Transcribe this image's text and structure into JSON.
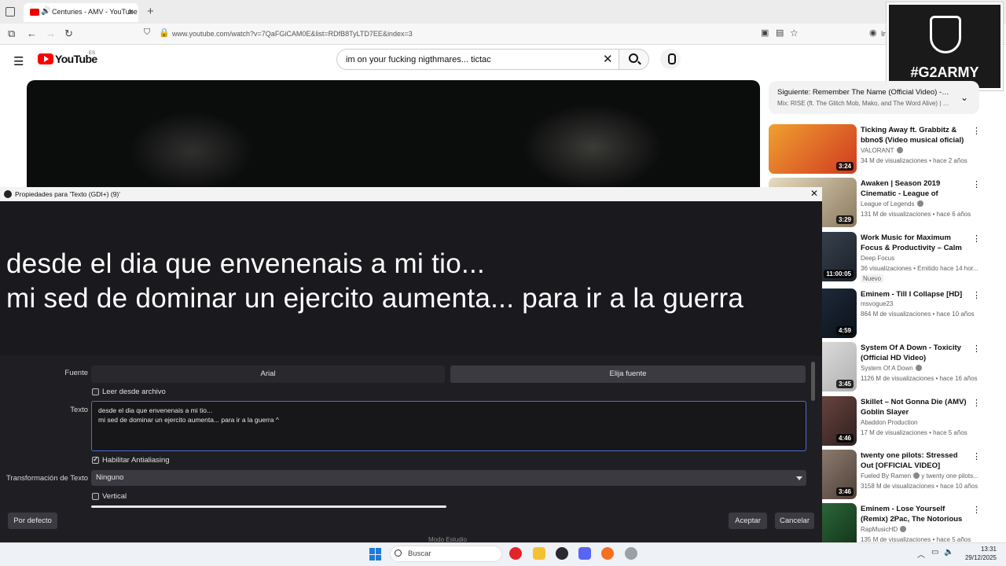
{
  "browser": {
    "tab_title": "Centuries - AMV - YouTube",
    "url": "www.youtube.com/watch?v=7QaFGiCAM0E&list=RDfB8TyLTD7EE&index=3",
    "profile_label": "In"
  },
  "youtube": {
    "logo": "YouTube",
    "country": "ES",
    "search_query": "im on your fucking nigthmares... tictac",
    "up_next": {
      "label": "Siguiente:",
      "title": "Remember The Name (Official Video) - F...",
      "subtitle": "Mix: RISE (ft. The Glitch Mob, Mako, and The Word Alive) | W..."
    },
    "recommendations": [
      {
        "title": "Ticking Away ft. Grabbitz & bbno$ (Video musical oficial) /...",
        "channel": "VALORANT",
        "verified": true,
        "meta": "34 M de visualizaciones • hace 2 años",
        "duration": "3:24",
        "badge": "",
        "color": "#e0542a"
      },
      {
        "title": "Awaken | Season 2019 Cinematic - League of Legend...",
        "channel": "League of Legends",
        "verified": true,
        "meta": "131 M de visualizaciones • hace 6 años",
        "duration": "3:29",
        "badge": "",
        "color": "#c9b690"
      },
      {
        "title": "Work Music for Maximum Focus & Productivity – Calm ...",
        "channel": "Deep Focus",
        "verified": false,
        "meta": "36 visualizaciones • Emitido hace 14 hor...",
        "duration": "11:00:05",
        "badge": "Nuevo",
        "color": "#2e3540"
      },
      {
        "title": "Eminem - Till I Collapse [HD]",
        "channel": "msvogue23",
        "verified": false,
        "meta": "864 M de visualizaciones • hace 10 años",
        "duration": "4:59",
        "badge": "",
        "color": "#1e2c3c"
      },
      {
        "title": "System Of A Down - Toxicity (Official HD Video)",
        "channel": "System Of A Down",
        "verified": true,
        "meta": "1126 M de visualizaciones • hace 16 años",
        "duration": "3:45",
        "badge": "",
        "color": "#3a3030"
      },
      {
        "title": "Skillet – Not Gonna Die (AMV) Goblin Slayer",
        "channel": "Abaddon Production",
        "verified": false,
        "meta": "17 M de visualizaciones • hace 5 años",
        "duration": "4:46",
        "badge": "",
        "color": "#5a4040"
      },
      {
        "title": "twenty one pilots: Stressed Out [OFFICIAL VIDEO]",
        "channel": "Fueled By Ramen",
        "verified": true,
        "meta": "3158 M de visualizaciones • hace 10 años",
        "duration": "3:46",
        "badge": "",
        "color": "#7a6a60",
        "channel_extra": "y twenty one pilots..."
      },
      {
        "title": "Eminem - Lose Yourself (Remix) 2Pac, The Notorious B.I.G., ...",
        "channel": "RapMusicHD",
        "verified": true,
        "meta": "135 M de visualizaciones • hace 5 años",
        "duration": "",
        "badge": "",
        "color": "#2f6a3a"
      }
    ]
  },
  "overlay": {
    "g2_text": "#G2ARMY"
  },
  "dialog": {
    "title": "Propiedades para 'Texto (GDI+) (9)'",
    "preview_line1": "desde el dia que envenenais a mi tio...",
    "preview_line2": "mi sed de dominar un ejercito aumenta... para ir a la guerra",
    "font_label": "Fuente",
    "font_value": "Arial",
    "font_button": "Elija fuente",
    "read_file_label": "Leer desde archivo",
    "read_file_checked": false,
    "text_label": "Texto",
    "text_value": "desde el dia que envenenais a mi tio...\nmi sed de dominar un ejercito aumenta... para ir a la guerra ^",
    "antialias_label": "Habilitar Antialiasing",
    "antialias_checked": true,
    "transform_label": "Transformación de Texto",
    "transform_value": "Ninguno",
    "vertical_label": "Vertical",
    "vertical_checked": false,
    "defaults_button": "Por defecto",
    "ok_button": "Aceptar",
    "cancel_button": "Cancelar",
    "studio_mode": "Modo Estudio"
  },
  "taskbar": {
    "search_placeholder": "Buscar",
    "time": "13:31",
    "date": "29/12/2025"
  }
}
